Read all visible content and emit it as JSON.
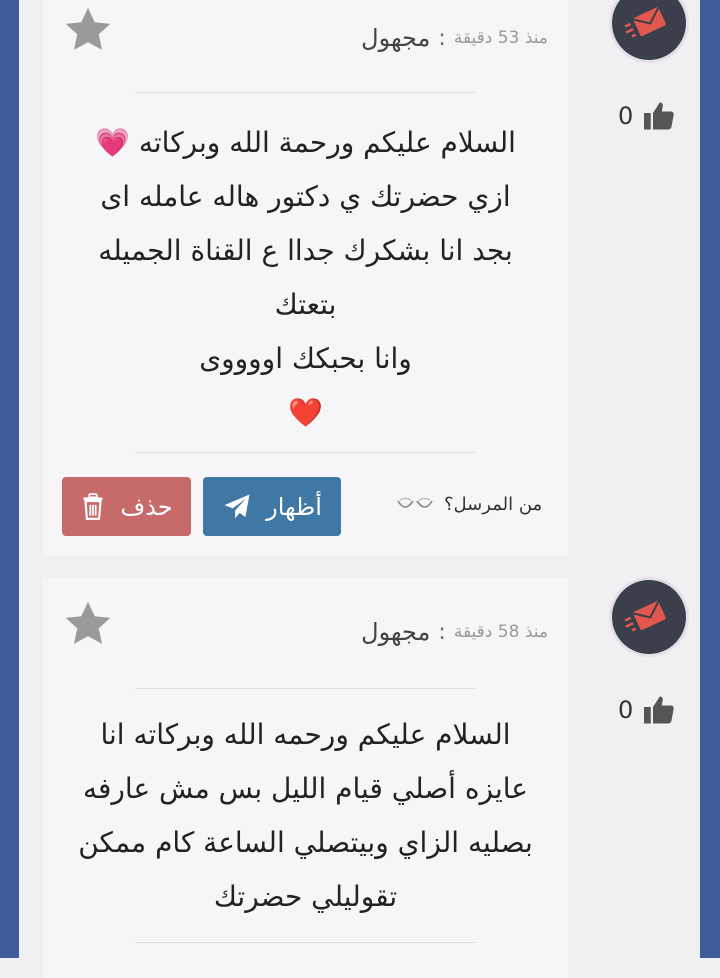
{
  "messages": [
    {
      "sender": "مجهول",
      "separator": ":",
      "time_ago": "منذ 53 دقيقة",
      "likes": "0",
      "lines": [
        "السلام عليكم ورحمة الله وبركاته 💗",
        "ازي حضرتك ي دكتور هاله عامله اى",
        "بجد انا بشكرك جداا ع القناة الجميله",
        "بتعتك",
        "وانا بحبكك اووووى",
        "❤️"
      ],
      "who_sender_label": "من المرسل؟",
      "show_button": "أظهار",
      "delete_button": "حذف"
    },
    {
      "sender": "مجهول",
      "separator": ":",
      "time_ago": "منذ 58 دقيقة",
      "likes": "0",
      "lines": [
        "السلام عليكم ورحمه الله وبركاته انا",
        "عايزه أصلي قيام الليل بس مش عارفه",
        "بصليه الزاي وبيتصلي الساعة كام ممكن",
        "تقوليلي حضرتك"
      ]
    }
  ],
  "colors": {
    "side_edge": "#3e5c9a",
    "show_button": "#3f78a5",
    "delete_button": "#c76a6a",
    "avatar_bg": "#3a3f4b",
    "avatar_icon": "#e2584e",
    "star": "#9a9a9a"
  },
  "icons": {
    "favorite": "star-icon",
    "like": "thumbs-up-icon",
    "avatar": "envelope-icon",
    "send": "paper-plane-icon",
    "trash": "trash-icon",
    "eyes": "eyes-icon"
  }
}
